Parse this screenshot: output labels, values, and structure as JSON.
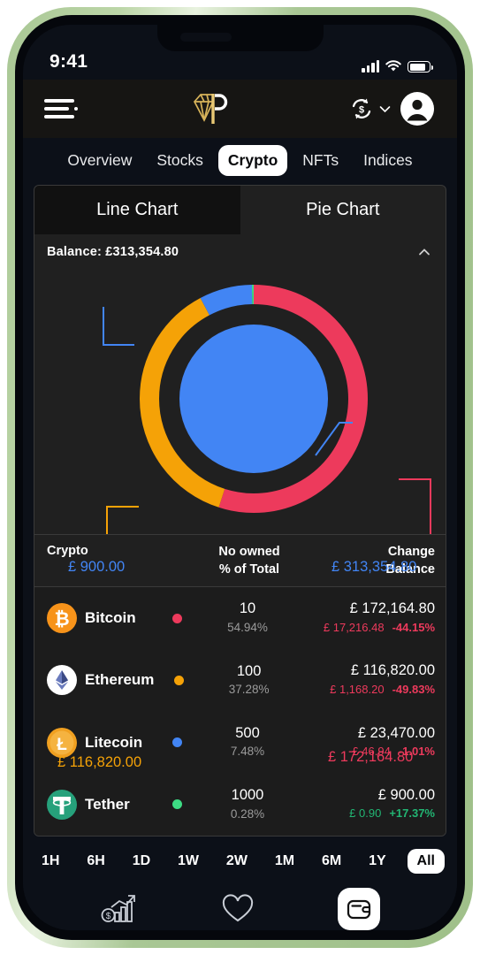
{
  "status_bar": {
    "time": "9:41",
    "signal_icon": "cellular-bars-icon",
    "wifi_icon": "wifi-icon",
    "battery_icon": "battery-icon"
  },
  "header": {
    "menu_icon": "hamburger-menu-icon",
    "logo_icon": "diamond-p-logo",
    "currency_swap_icon": "currency-swap-icon",
    "chevron_icon": "chevron-down-icon",
    "account_icon": "account-avatar-icon"
  },
  "main_tabs": [
    {
      "label": "Overview",
      "active": false
    },
    {
      "label": "Stocks",
      "active": false
    },
    {
      "label": "Crypto",
      "active": true
    },
    {
      "label": "NFTs",
      "active": false
    },
    {
      "label": "Indices",
      "active": false
    }
  ],
  "chart_tabs": [
    {
      "label": "Line Chart",
      "active": true
    },
    {
      "label": "Pie Chart",
      "active": false
    }
  ],
  "balance": {
    "label": "Balance: £313,354.80",
    "collapse_icon": "chevron-up-icon"
  },
  "chart_data": {
    "type": "pie",
    "title": "Balance: £313,354.80",
    "legend_position": "table-below",
    "center_total_label": "£ 313,354.80",
    "center_total_value": 313354.8,
    "currency": "£",
    "categories": [
      "Bitcoin",
      "Ethereum",
      "Litecoin",
      "Tether"
    ],
    "values": [
      172164.8,
      116820.0,
      23470.0,
      900.0
    ],
    "percents": [
      54.94,
      37.28,
      7.48,
      0.28
    ],
    "colors": [
      "#ed3a5c",
      "#f5a207",
      "#4285f4",
      "#3ddc84"
    ],
    "labels": [
      "£ 172,164.80",
      "£ 116,820.00",
      "£ 23,470.00",
      "£ 900.00"
    ],
    "shown_labels": [
      {
        "text": "£ 313,354.80",
        "color": "#4285f4",
        "target": "center-total"
      },
      {
        "text": "£ 172,164.80",
        "color": "#ed3a5c",
        "target": "bitcoin-segment"
      },
      {
        "text": "£ 116,820.00",
        "color": "#f5a207",
        "target": "ethereum-segment"
      },
      {
        "text": "£ 900.00",
        "color": "#4285f4",
        "target": "litecoin-segment"
      }
    ]
  },
  "table": {
    "headers": {
      "crypto": "Crypto",
      "owned_line1": "No owned",
      "owned_line2": "% of Total",
      "change_line1": "Change",
      "change_line2": "Balance"
    },
    "rows": [
      {
        "name": "Bitcoin",
        "icon": "bitcoin-icon",
        "symbol": "₿",
        "dot_color": "#ed3a5c",
        "owned": "10",
        "percent": "54.94%",
        "balance": "£ 172,164.80",
        "change_amount": "£ 17,216.48",
        "change_percent": "-44.15%",
        "direction": "neg"
      },
      {
        "name": "Ethereum",
        "icon": "ethereum-icon",
        "symbol": "Ξ",
        "dot_color": "#f5a207",
        "owned": "100",
        "percent": "37.28%",
        "balance": "£ 116,820.00",
        "change_amount": "£ 1,168.20",
        "change_percent": "-49.83%",
        "direction": "neg"
      },
      {
        "name": "Litecoin",
        "icon": "litecoin-icon",
        "symbol": "Ł",
        "dot_color": "#4285f4",
        "owned": "500",
        "percent": "7.48%",
        "balance": "£ 23,470.00",
        "change_amount": "£ 46.94",
        "change_percent": "-1.01%",
        "direction": "neg"
      },
      {
        "name": "Tether",
        "icon": "tether-icon",
        "symbol": "₮",
        "dot_color": "#3ddc84",
        "owned": "1000",
        "percent": "0.28%",
        "balance": "£ 900.00",
        "change_amount": "£ 0.90",
        "change_percent": "+17.37%",
        "direction": "pos"
      }
    ]
  },
  "ranges": [
    {
      "label": "1H",
      "active": false
    },
    {
      "label": "6H",
      "active": false
    },
    {
      "label": "1D",
      "active": false
    },
    {
      "label": "1W",
      "active": false
    },
    {
      "label": "2W",
      "active": false
    },
    {
      "label": "1M",
      "active": false
    },
    {
      "label": "6M",
      "active": false
    },
    {
      "label": "1Y",
      "active": false
    },
    {
      "label": "All",
      "active": true
    }
  ],
  "bottom_nav": [
    {
      "icon": "market-growth-chart-icon",
      "active": false
    },
    {
      "icon": "heart-favorites-icon",
      "active": false
    },
    {
      "icon": "wallet-icon",
      "active": true
    }
  ]
}
